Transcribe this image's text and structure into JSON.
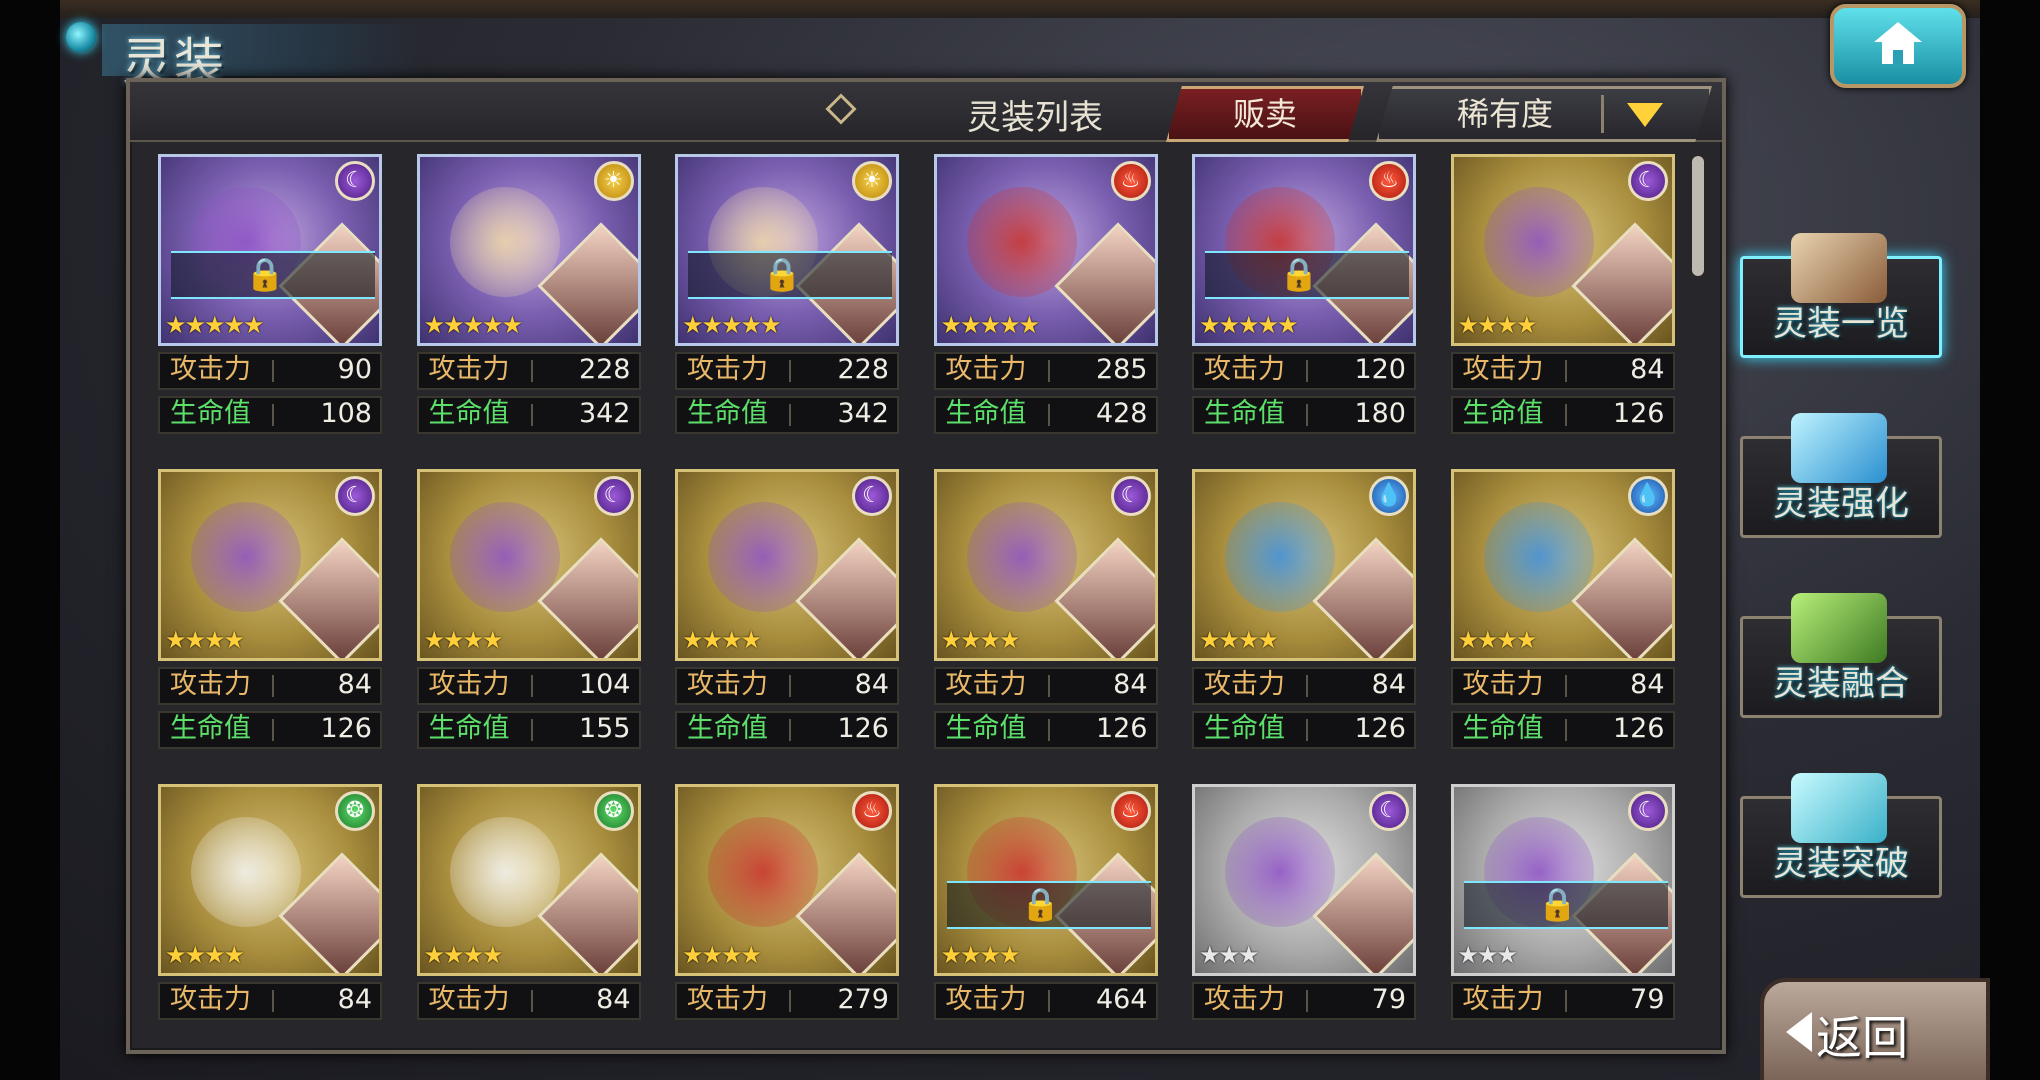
{
  "header": {
    "title": "灵装",
    "home_icon": "home-icon"
  },
  "panel": {
    "list_title": "灵装列表",
    "sell_label": "贩卖",
    "sort_label": "稀有度"
  },
  "stat_labels": {
    "atk": "攻击力",
    "hp": "生命值"
  },
  "cards": [
    {
      "element": "moon",
      "frame": "purple",
      "rarity": 5,
      "locked": true,
      "atk": "90",
      "hp": "108"
    },
    {
      "element": "sun",
      "frame": "purple",
      "rarity": 5,
      "locked": false,
      "atk": "228",
      "hp": "342"
    },
    {
      "element": "sun",
      "frame": "purple",
      "rarity": 5,
      "locked": true,
      "atk": "228",
      "hp": "342"
    },
    {
      "element": "fire",
      "frame": "purple",
      "rarity": 5,
      "locked": false,
      "atk": "285",
      "hp": "428"
    },
    {
      "element": "fire",
      "frame": "purple",
      "rarity": 5,
      "locked": true,
      "atk": "120",
      "hp": "180"
    },
    {
      "element": "moon",
      "frame": "gold",
      "rarity": 4,
      "locked": false,
      "atk": "84",
      "hp": "126"
    },
    {
      "element": "moon",
      "frame": "gold",
      "rarity": 4,
      "locked": false,
      "atk": "84",
      "hp": "126"
    },
    {
      "element": "moon",
      "frame": "gold",
      "rarity": 4,
      "locked": false,
      "atk": "104",
      "hp": "155"
    },
    {
      "element": "moon",
      "frame": "gold",
      "rarity": 4,
      "locked": false,
      "atk": "84",
      "hp": "126"
    },
    {
      "element": "moon",
      "frame": "gold",
      "rarity": 4,
      "locked": false,
      "atk": "84",
      "hp": "126"
    },
    {
      "element": "water",
      "frame": "gold",
      "rarity": 4,
      "locked": false,
      "atk": "84",
      "hp": "126"
    },
    {
      "element": "water",
      "frame": "gold",
      "rarity": 4,
      "locked": false,
      "atk": "84",
      "hp": "126"
    },
    {
      "element": "wind",
      "frame": "gold",
      "rarity": 4,
      "locked": false,
      "atk": "84",
      "hp": ""
    },
    {
      "element": "wind",
      "frame": "gold",
      "rarity": 4,
      "locked": false,
      "atk": "84",
      "hp": ""
    },
    {
      "element": "fire",
      "frame": "gold",
      "rarity": 4,
      "locked": false,
      "atk": "279",
      "hp": ""
    },
    {
      "element": "fire",
      "frame": "gold",
      "rarity": 4,
      "locked": true,
      "atk": "464",
      "hp": ""
    },
    {
      "element": "moon",
      "frame": "silver",
      "rarity": 3,
      "locked": false,
      "atk": "79",
      "hp": ""
    },
    {
      "element": "moon",
      "frame": "silver",
      "rarity": 3,
      "locked": true,
      "atk": "79",
      "hp": ""
    }
  ],
  "menu": [
    {
      "label": "灵装一览",
      "icon": "book-icon",
      "active": true
    },
    {
      "label": "灵装强化",
      "icon": "crystal-icon",
      "active": false
    },
    {
      "label": "灵装融合",
      "icon": "potion-icon",
      "active": false
    },
    {
      "label": "灵装突破",
      "icon": "gem-icon",
      "active": false
    }
  ],
  "back_label": "返回"
}
